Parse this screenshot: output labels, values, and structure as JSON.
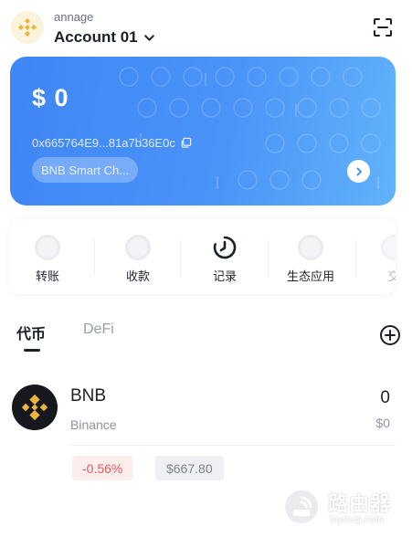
{
  "header": {
    "wallet_label": "annage",
    "account_name": "Account 01",
    "icons": {
      "logo": "bnb-logo-icon",
      "dropdown": "chevron-down-icon",
      "scan": "scan-icon"
    }
  },
  "card": {
    "balance": "$ 0",
    "address": "0x665764E9...81a7b36E0c",
    "network": "BNB Smart Ch...",
    "colors": {
      "gradient_start": "#3f86f6",
      "gradient_end": "#62b2fb"
    },
    "icons": {
      "copy": "copy-icon",
      "arrow": "chevron-right-icon"
    }
  },
  "actions": [
    {
      "label": "转账",
      "icon": "transfer-icon"
    },
    {
      "label": "收款",
      "icon": "receive-icon"
    },
    {
      "label": "记录",
      "icon": "history-clock-icon"
    },
    {
      "label": "生态应用",
      "icon": "apps-icon"
    },
    {
      "label": "交",
      "icon": "swap-icon"
    }
  ],
  "tabs": {
    "token": "代币",
    "defi": "DeFi",
    "add_icon": "add-circle-icon"
  },
  "tokens": [
    {
      "symbol": "BNB",
      "chain": "Binance",
      "amount": "0",
      "usd_value": "$0",
      "change": "-0.56%",
      "price": "$667.80",
      "colors": {
        "change_text": "#e2585b",
        "change_bg": "#fdeeee"
      }
    }
  ],
  "watermark": {
    "text": "路由器",
    "sub": "luyouqi.com"
  }
}
